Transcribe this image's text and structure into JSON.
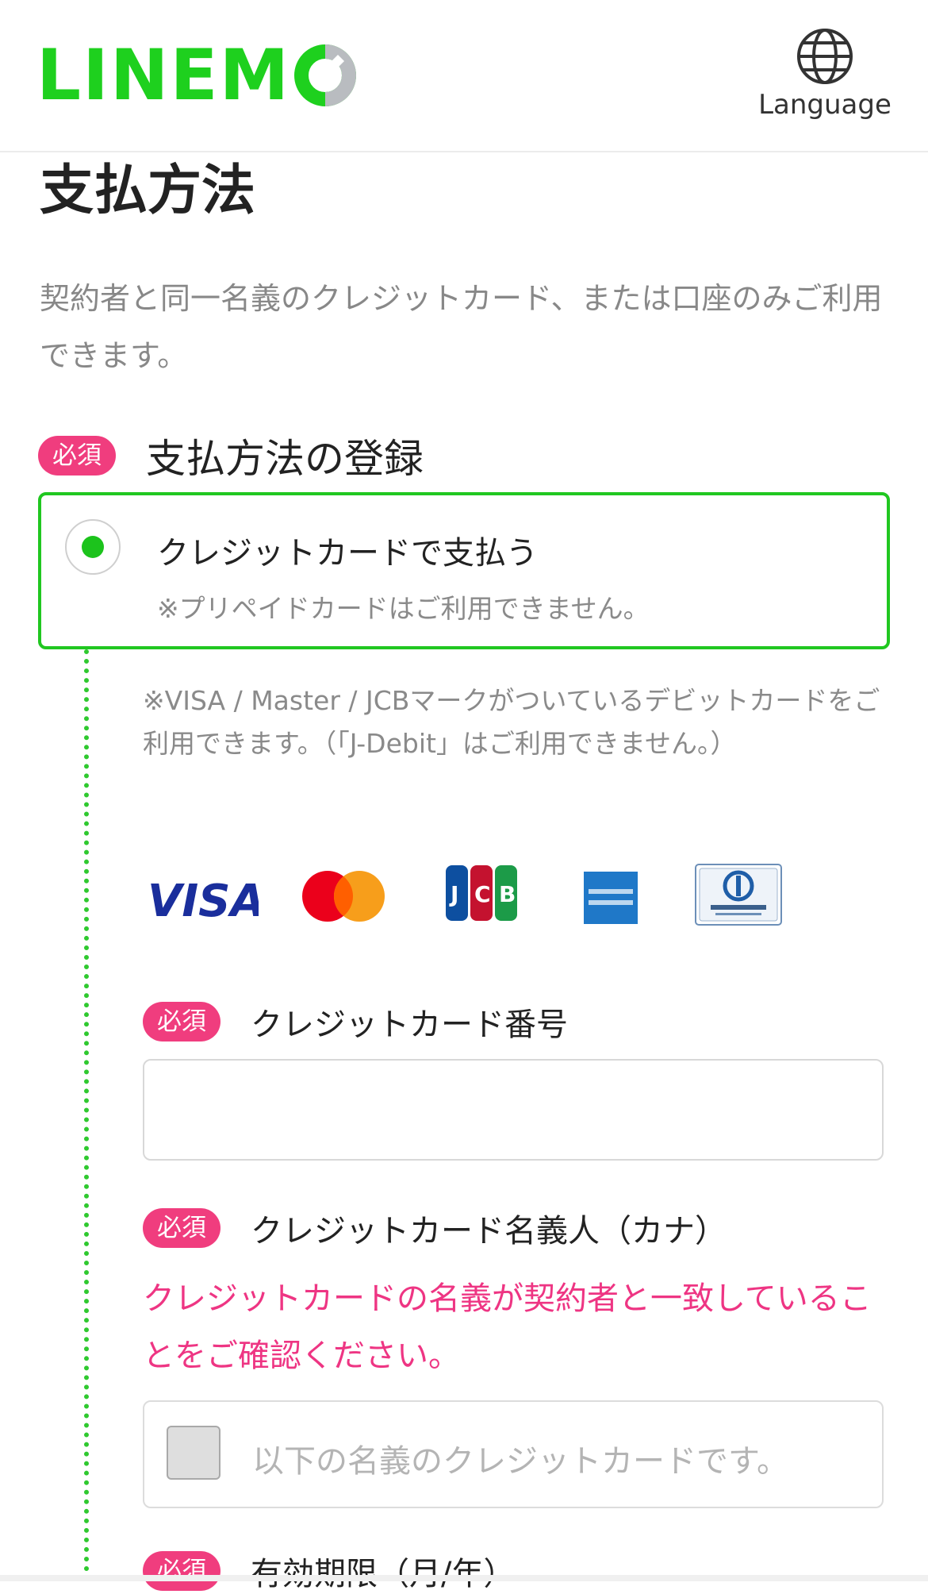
{
  "header": {
    "logo_text": "LINEM",
    "logo_colors": {
      "text": "#1ed01e",
      "ring": "#b9bcc0"
    },
    "language_label": "Language",
    "language_icon": "globe-icon"
  },
  "page": {
    "title": "支払方法",
    "intro": "契約者と同一名義のクレジットカード、または口座のみご利用できます。"
  },
  "payment_section": {
    "required_badge": "必須",
    "title": "支払方法の登録",
    "option": {
      "label": "クレジットカードで支払う",
      "note": "※プリペイドカードはご利用できません。",
      "selected": true
    },
    "debit_note": "※VISA / Master / JCBマークがついているデビットカードをご利用できます。（「J-Debit」はご利用できません。）",
    "card_brands": [
      {
        "name": "VISA",
        "icon": "visa-icon"
      },
      {
        "name": "Mastercard",
        "icon": "mastercard-icon"
      },
      {
        "name": "JCB",
        "icon": "jcb-icon"
      },
      {
        "name": "American Express",
        "icon": "amex-icon"
      },
      {
        "name": "Diners Club",
        "icon": "diners-club-icon"
      }
    ]
  },
  "card_number": {
    "required_badge": "必須",
    "label": "クレジットカード番号",
    "value": "",
    "placeholder": ""
  },
  "card_holder": {
    "required_badge": "必須",
    "label": "クレジットカード名義人（カナ）",
    "warning": "クレジットカードの名義が契約者と一致していることをご確認ください。",
    "checkbox_label": "以下の名義のクレジットカードです。",
    "checked": false
  },
  "expiry": {
    "required_badge": "必須",
    "label": "有効期限（月/年）"
  },
  "colors": {
    "accent_green": "#20c720",
    "required_pink": "#f03d7e",
    "warning_pink": "#ee3583",
    "muted_text": "#8a8a8a"
  }
}
